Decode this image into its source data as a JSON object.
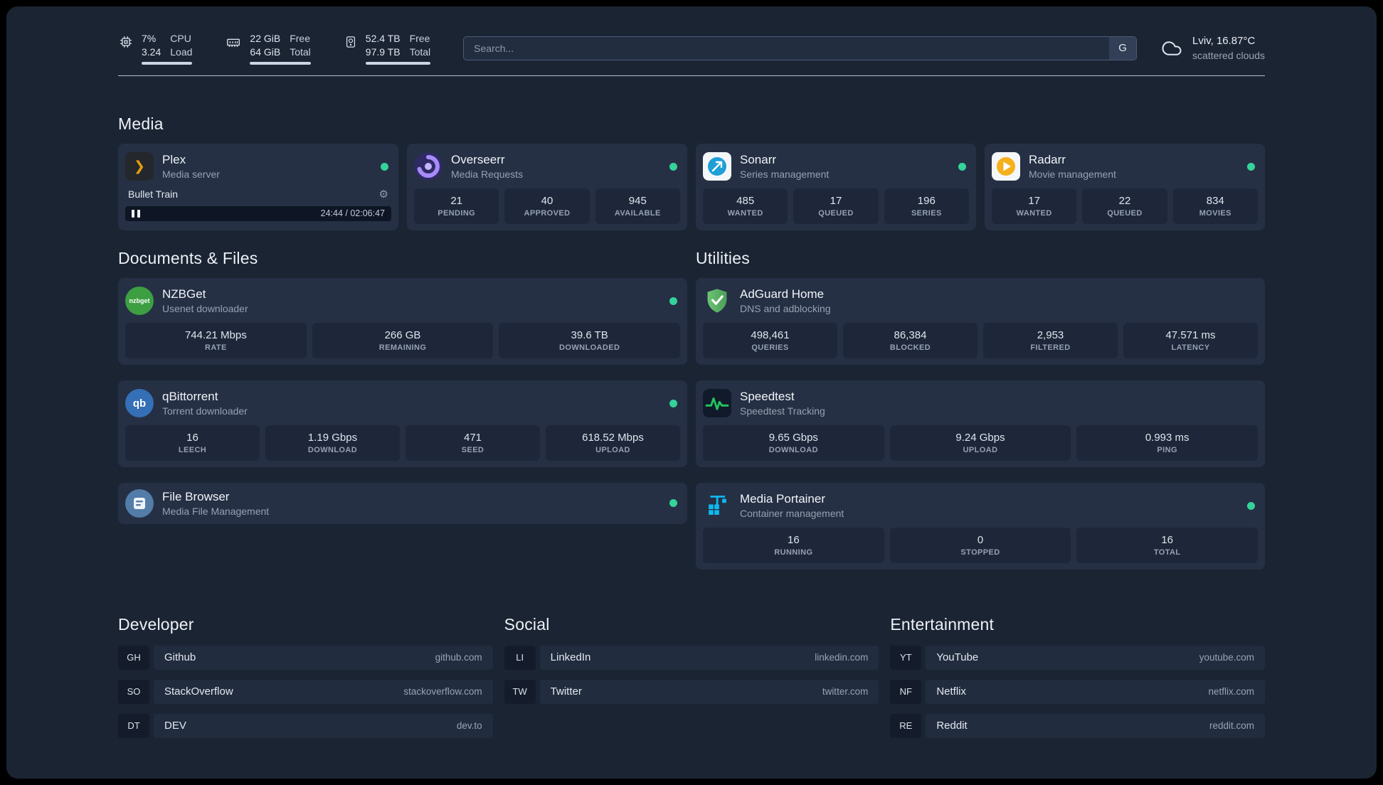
{
  "topbar": {
    "cpu": {
      "value1": "7%",
      "value2": "3.24",
      "label1": "CPU",
      "label2": "Load",
      "bar_percent": 100
    },
    "memory": {
      "value1": "22 GiB",
      "value2": "64 GiB",
      "label1": "Free",
      "label2": "Total",
      "bar_percent": 100
    },
    "disk": {
      "value1": "52.4 TB",
      "value2": "97.9 TB",
      "label1": "Free",
      "label2": "Total",
      "bar_percent": 100
    },
    "search": {
      "placeholder": "Search...",
      "button_label": "G"
    },
    "weather": {
      "location": "Lviv, 16.87°C",
      "condition": "scattered clouds"
    }
  },
  "icons": {
    "plex_glyph": "❯",
    "gear": "⚙",
    "qbittorrent_text": "qb",
    "nzbget_text": "nzbget"
  },
  "media": {
    "title": "Media",
    "plex": {
      "name": "Plex",
      "description": "Media server",
      "now_playing": "Bullet Train",
      "time": "24:44 / 02:06:47"
    },
    "overseerr": {
      "name": "Overseerr",
      "description": "Media Requests",
      "stats": [
        {
          "value": "21",
          "label": "PENDING"
        },
        {
          "value": "40",
          "label": "APPROVED"
        },
        {
          "value": "945",
          "label": "AVAILABLE"
        }
      ]
    },
    "sonarr": {
      "name": "Sonarr",
      "description": "Series management",
      "stats": [
        {
          "value": "485",
          "label": "WANTED"
        },
        {
          "value": "17",
          "label": "QUEUED"
        },
        {
          "value": "196",
          "label": "SERIES"
        }
      ]
    },
    "radarr": {
      "name": "Radarr",
      "description": "Movie management",
      "stats": [
        {
          "value": "17",
          "label": "WANTED"
        },
        {
          "value": "22",
          "label": "QUEUED"
        },
        {
          "value": "834",
          "label": "MOVIES"
        }
      ]
    }
  },
  "documents": {
    "title": "Documents & Files",
    "nzbget": {
      "name": "NZBGet",
      "description": "Usenet downloader",
      "stats": [
        {
          "value": "744.21 Mbps",
          "label": "RATE"
        },
        {
          "value": "266 GB",
          "label": "REMAINING"
        },
        {
          "value": "39.6 TB",
          "label": "DOWNLOADED"
        }
      ]
    },
    "qbittorrent": {
      "name": "qBittorrent",
      "description": "Torrent downloader",
      "stats": [
        {
          "value": "16",
          "label": "LEECH"
        },
        {
          "value": "1.19 Gbps",
          "label": "DOWNLOAD"
        },
        {
          "value": "471",
          "label": "SEED"
        },
        {
          "value": "618.52 Mbps",
          "label": "UPLOAD"
        }
      ]
    },
    "filebrowser": {
      "name": "File Browser",
      "description": "Media File Management"
    }
  },
  "utilities": {
    "title": "Utilities",
    "adguard": {
      "name": "AdGuard Home",
      "description": "DNS and adblocking",
      "stats": [
        {
          "value": "498,461",
          "label": "QUERIES"
        },
        {
          "value": "86,384",
          "label": "BLOCKED"
        },
        {
          "value": "2,953",
          "label": "FILTERED"
        },
        {
          "value": "47.571 ms",
          "label": "LATENCY"
        }
      ]
    },
    "speedtest": {
      "name": "Speedtest",
      "description": "Speedtest Tracking",
      "stats": [
        {
          "value": "9.65 Gbps",
          "label": "DOWNLOAD"
        },
        {
          "value": "9.24 Gbps",
          "label": "UPLOAD"
        },
        {
          "value": "0.993 ms",
          "label": "PING"
        }
      ]
    },
    "portainer": {
      "name": "Media Portainer",
      "description": "Container management",
      "stats": [
        {
          "value": "16",
          "label": "RUNNING"
        },
        {
          "value": "0",
          "label": "STOPPED"
        },
        {
          "value": "16",
          "label": "TOTAL"
        }
      ]
    }
  },
  "bookmarks": {
    "developer": {
      "title": "Developer",
      "items": [
        {
          "abbr": "GH",
          "name": "Github",
          "domain": "github.com"
        },
        {
          "abbr": "SO",
          "name": "StackOverflow",
          "domain": "stackoverflow.com"
        },
        {
          "abbr": "DT",
          "name": "DEV",
          "domain": "dev.to"
        }
      ]
    },
    "social": {
      "title": "Social",
      "items": [
        {
          "abbr": "LI",
          "name": "LinkedIn",
          "domain": "linkedin.com"
        },
        {
          "abbr": "TW",
          "name": "Twitter",
          "domain": "twitter.com"
        }
      ]
    },
    "entertainment": {
      "title": "Entertainment",
      "items": [
        {
          "abbr": "YT",
          "name": "YouTube",
          "domain": "youtube.com"
        },
        {
          "abbr": "NF",
          "name": "Netflix",
          "domain": "netflix.com"
        },
        {
          "abbr": "RE",
          "name": "Reddit",
          "domain": "reddit.com"
        }
      ]
    }
  },
  "colors": {
    "page_bg": "#1b2433",
    "card_bg": "#253044",
    "status_green": "#35d29a",
    "plex_amber": "#e5a00d",
    "portainer_blue": "#0db9f0",
    "adguard_green": "#5fb668"
  }
}
